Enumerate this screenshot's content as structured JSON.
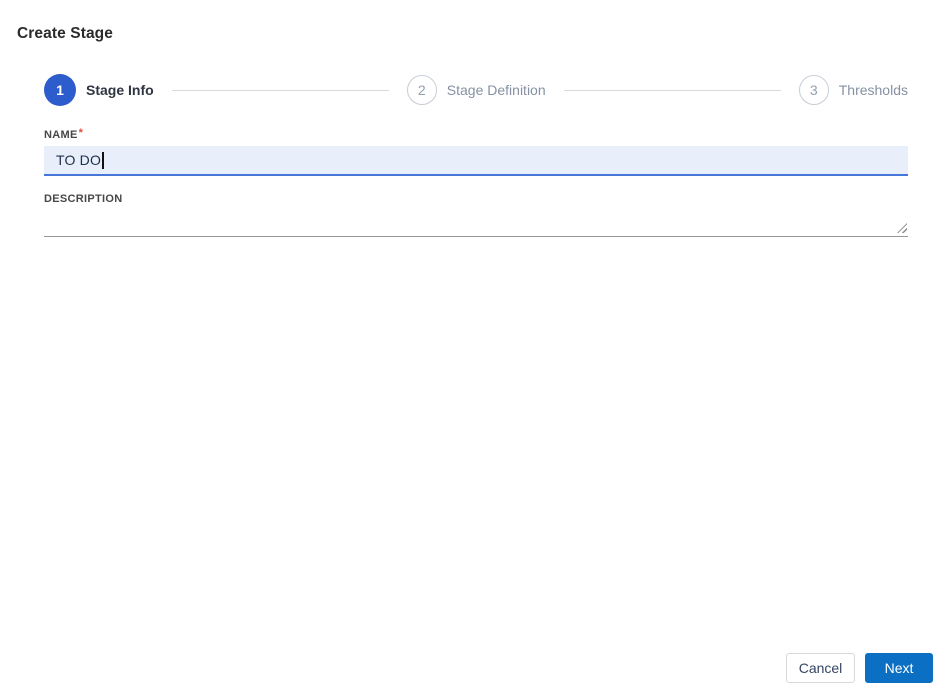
{
  "window": {
    "title": "Create Stage"
  },
  "stepper": {
    "steps": [
      {
        "number": "1",
        "label": "Stage Info",
        "state": "active"
      },
      {
        "number": "2",
        "label": "Stage Definition",
        "state": "upcoming"
      },
      {
        "number": "3",
        "label": "Thresholds",
        "state": "upcoming"
      }
    ]
  },
  "form": {
    "name": {
      "label": "NAME",
      "required_marker": "*",
      "value": "TO DO"
    },
    "description": {
      "label": "DESCRIPTION",
      "value": ""
    }
  },
  "actions": {
    "cancel": "Cancel",
    "next": "Next"
  },
  "colors": {
    "active_step_blue": "#2d5ccc",
    "primary_button_blue": "#0b6fc4",
    "focused_input_bg": "#e8effb",
    "focused_input_underline": "#4677d8",
    "required_asterisk_red": "#e5493a",
    "inactive_step_gray": "#8691a3",
    "connector_gray": "#d9d9d9"
  }
}
